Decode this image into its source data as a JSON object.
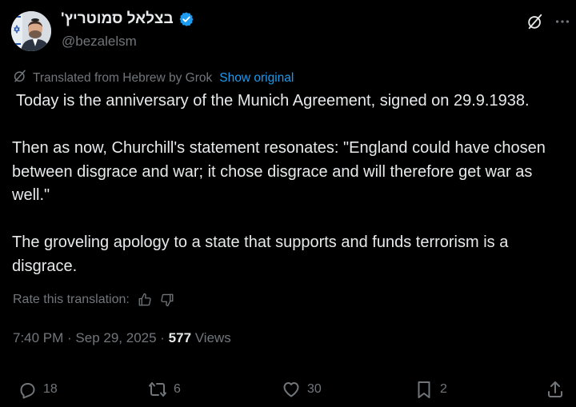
{
  "author": {
    "display_name": "בצלאל סמוטריץ'",
    "handle": "@bezalelsm",
    "verified": true,
    "verified_color": "#1d9bf0"
  },
  "header_icons": {
    "grok": "grok-icon",
    "more": "more-icon"
  },
  "translation": {
    "note": "Translated from Hebrew by Grok",
    "show_original": "Show original",
    "link_color": "#1d9bf0"
  },
  "post": {
    "paragraphs": [
      "Today is the anniversary of the Munich Agreement, signed on 29.9.1938.",
      "Then as now, Churchill's statement resonates: \"England could have chosen between disgrace and war; it chose disgrace and will therefore get war as well.\"",
      "The groveling apology to a state that supports and funds terrorism is a disgrace."
    ]
  },
  "rating": {
    "label": "Rate this translation:",
    "up_icon": "thumbs-up-icon",
    "down_icon": "thumbs-down-icon"
  },
  "meta": {
    "timestamp": "7:40 PM · Sep 29, 2025 · ",
    "views_count": "577",
    "views_label": " Views"
  },
  "actions": {
    "replies": "18",
    "reposts": "6",
    "likes": "30",
    "bookmarks": "2"
  },
  "colors": {
    "background": "#000000",
    "text": "#e7e9ea",
    "muted": "#71767b",
    "accent": "#1d9bf0"
  }
}
